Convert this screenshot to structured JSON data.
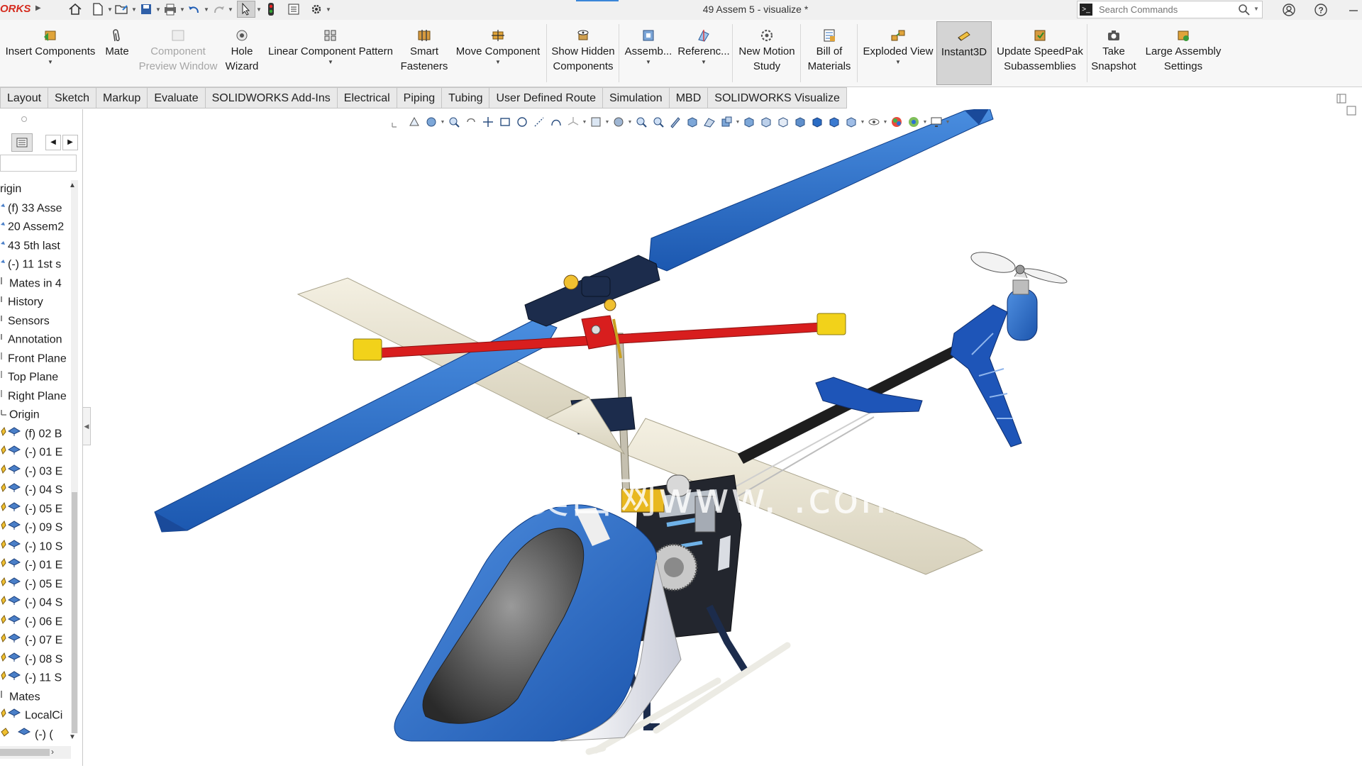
{
  "app": {
    "logo_text": "ORKS",
    "document_title": "49 Assem 5 - visualize *"
  },
  "search": {
    "placeholder": "Search Commands",
    "prompt_glyph": ">_"
  },
  "ribbon": {
    "buttons": [
      {
        "id": "insert-components",
        "label": "Insert Components",
        "dropdown": true,
        "icon": "insert-components-icon"
      },
      {
        "id": "mate",
        "label": "Mate",
        "dropdown": false,
        "icon": "mate-paperclip-icon"
      },
      {
        "id": "component-preview-window",
        "label": "Component\nPreview Window",
        "dropdown": false,
        "disabled": true,
        "icon": "preview-window-icon"
      },
      {
        "id": "hole-wizard",
        "label": "Hole\nWizard",
        "dropdown": false,
        "icon": "hole-wizard-icon"
      },
      {
        "id": "linear-component-pattern",
        "label": "Linear Component Pattern",
        "dropdown": true,
        "icon": "linear-pattern-icon"
      },
      {
        "id": "smart-fasteners",
        "label": "Smart\nFasteners",
        "dropdown": false,
        "icon": "smart-fasteners-icon"
      },
      {
        "id": "move-component",
        "label": "Move Component",
        "dropdown": true,
        "icon": "move-component-icon"
      },
      {
        "id": "show-hidden-components",
        "label": "Show Hidden\nComponents",
        "dropdown": false,
        "icon": "show-hidden-icon"
      },
      {
        "id": "assembly-features",
        "label": "Assemb...",
        "dropdown": true,
        "icon": "assembly-features-icon"
      },
      {
        "id": "reference-geometry",
        "label": "Referenc...",
        "dropdown": true,
        "icon": "reference-geometry-icon"
      },
      {
        "id": "new-motion-study",
        "label": "New Motion\nStudy",
        "dropdown": false,
        "icon": "motion-study-icon"
      },
      {
        "id": "bill-of-materials",
        "label": "Bill of\nMaterials",
        "dropdown": false,
        "icon": "bom-icon"
      },
      {
        "id": "exploded-view",
        "label": "Exploded View",
        "dropdown": true,
        "icon": "exploded-view-icon"
      },
      {
        "id": "instant3d",
        "label": "Instant3D",
        "dropdown": false,
        "active": true,
        "icon": "instant3d-icon"
      },
      {
        "id": "update-speedpak",
        "label": "Update SpeedPak\nSubassemblies",
        "dropdown": false,
        "icon": "speedpak-icon"
      },
      {
        "id": "take-snapshot",
        "label": "Take\nSnapshot",
        "dropdown": false,
        "icon": "camera-icon"
      },
      {
        "id": "large-assembly-settings",
        "label": "Large Assembly\nSettings",
        "dropdown": false,
        "icon": "large-assembly-icon"
      }
    ]
  },
  "tabs": [
    "Layout",
    "Sketch",
    "Markup",
    "Evaluate",
    "SOLIDWORKS Add-Ins",
    "Electrical",
    "Piping",
    "Tubing",
    "User Defined Route",
    "Simulation",
    "MBD",
    "SOLIDWORKS Visualize"
  ],
  "tree": {
    "items": [
      {
        "label": "rigin",
        "icon": "none"
      },
      {
        "label": "(f) 33 Asse",
        "icon": "component-icon"
      },
      {
        "label": "20 Assem2",
        "icon": "component-icon"
      },
      {
        "label": "43 5th last",
        "icon": "component-icon"
      },
      {
        "label": "(-) 11 1st s",
        "icon": "component-icon"
      },
      {
        "label": "Mates in 4",
        "icon": "mates-icon"
      },
      {
        "label": "History",
        "icon": "history-icon"
      },
      {
        "label": "Sensors",
        "icon": "sensors-icon"
      },
      {
        "label": "Annotation",
        "icon": "annotation-icon"
      },
      {
        "label": "Front Plane",
        "icon": "plane-icon"
      },
      {
        "label": "Top Plane",
        "icon": "plane-icon"
      },
      {
        "label": "Right Plane",
        "icon": "plane-icon"
      },
      {
        "label": "Origin",
        "icon": "origin-icon"
      },
      {
        "label": "(f) 02 B",
        "icon": "component-icon"
      },
      {
        "label": "(-) 01 E",
        "icon": "component-icon"
      },
      {
        "label": "(-) 03 E",
        "icon": "component-icon"
      },
      {
        "label": "(-) 04 S",
        "icon": "component-icon"
      },
      {
        "label": "(-) 05 E",
        "icon": "component-icon"
      },
      {
        "label": "(-) 09 S",
        "icon": "component-icon"
      },
      {
        "label": "(-) 10 S",
        "icon": "component-icon"
      },
      {
        "label": "(-) 01 E",
        "icon": "component-icon"
      },
      {
        "label": "(-) 05 E",
        "icon": "component-icon"
      },
      {
        "label": "(-) 04 S",
        "icon": "component-icon"
      },
      {
        "label": "(-) 06 E",
        "icon": "component-icon"
      },
      {
        "label": "(-) 07 E",
        "icon": "component-icon"
      },
      {
        "label": "(-) 08 S",
        "icon": "component-icon"
      },
      {
        "label": "(-) 11 S",
        "icon": "component-icon"
      },
      {
        "label": "Mates",
        "icon": "mates-icon"
      },
      {
        "label": "LocalCi",
        "icon": "component-icon"
      },
      {
        "label": "(-) (",
        "icon": "component-icon"
      }
    ]
  },
  "viewport": {
    "watermark": "莫西网www.          .com"
  },
  "colors": {
    "blade_blue": "#2a6cc4",
    "blade_cream": "#ebe6d5",
    "flybar_red": "#d81e1e",
    "weight_yellow": "#f2d21a",
    "frame_navy": "#1c2c4c",
    "ribbon_bg": "#f7f7f7",
    "active_button": "#d4d4d4"
  }
}
